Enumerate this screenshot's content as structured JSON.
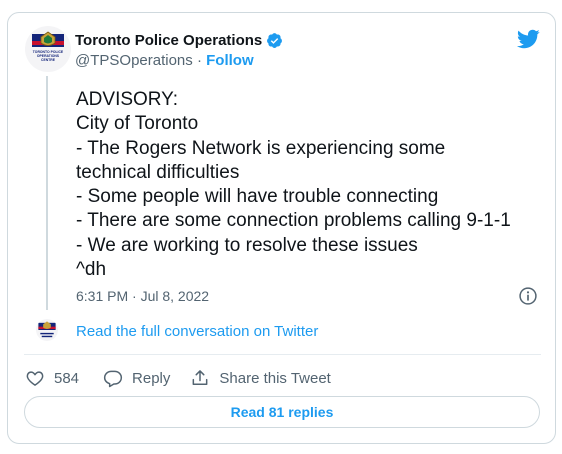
{
  "author": {
    "display_name": "Toronto Police Operations",
    "handle": "@TPSOperations",
    "separator": " · ",
    "follow_label": "Follow",
    "logo_text": [
      "TORONTO POLICE",
      "OPERATIONS",
      "CENTRE"
    ]
  },
  "tweet": {
    "lines": [
      "ADVISORY:",
      "City of Toronto",
      "- The Rogers Network is experiencing some",
      "technical difficulties",
      "- Some people will have trouble connecting",
      "- There are some connection problems calling 9-1-1",
      "- We are working to resolve these issues",
      "^dh"
    ],
    "timestamp": "6:31 PM · Jul 8, 2022"
  },
  "conversation_link": "Read the full conversation on Twitter",
  "actions": {
    "like_count": "584",
    "reply_label": "Reply",
    "share_label": "Share this Tweet"
  },
  "read_replies_label": "Read 81 replies",
  "colors": {
    "accent": "#1d9bf0",
    "text": "#0f1419",
    "secondary": "#536471",
    "border": "#cfd9de"
  },
  "icons": [
    "twitter-bird-icon",
    "verified-badge-icon",
    "info-icon",
    "heart-icon",
    "reply-icon",
    "share-icon"
  ]
}
